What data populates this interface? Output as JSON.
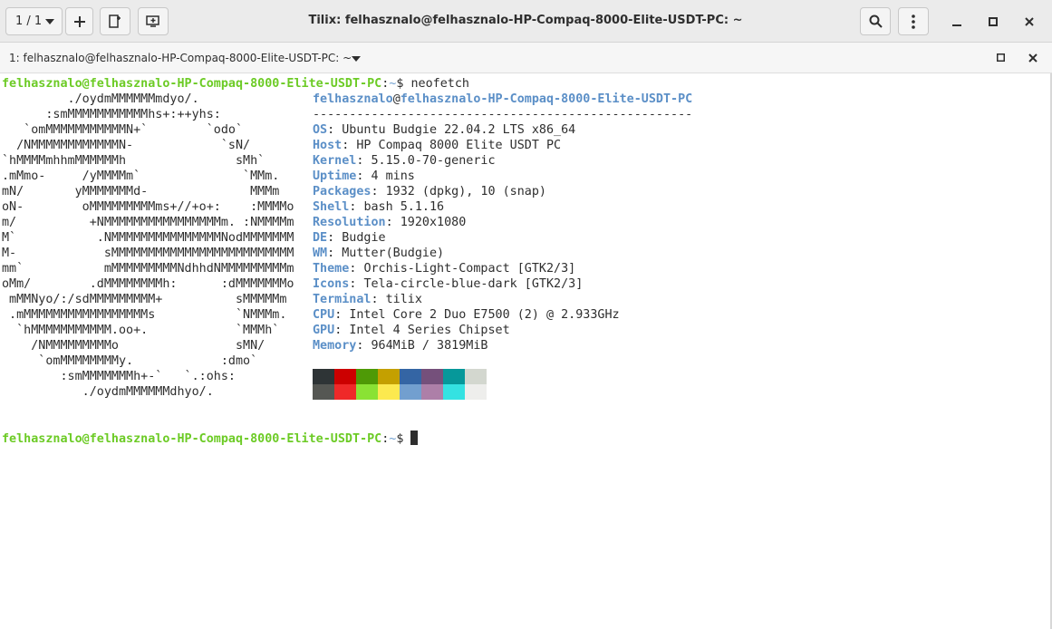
{
  "window": {
    "title": "Tilix: felhasznalo@felhasznalo-HP-Compaq-8000-Elite-USDT-PC: ~"
  },
  "headerbar": {
    "session_indicator": "1 / 1",
    "icons": [
      "chevron-down-icon",
      "plus-icon",
      "add-terminal-icon",
      "add-session-icon",
      "search-icon",
      "kebab-menu-icon",
      "minimize-icon",
      "maximize-icon",
      "close-icon"
    ]
  },
  "terminal_tab": {
    "title": "1: felhasznalo@felhasznalo-HP-Compaq-8000-Elite-USDT-PC: ~"
  },
  "prompt": {
    "user_host": "felhasznalo@felhasznalo-HP-Compaq-8000-Elite-USDT-PC",
    "sep": ":",
    "path": "~",
    "symbol": "$",
    "command": " neofetch"
  },
  "neofetch": {
    "logo_lines": [
      "         ./oydmMMMMMMmdyo/.",
      "      :smMMMMMMMMMMMhs+:++yhs:",
      "   `omMMMMMMMMMMMN+`        `odo`",
      "  /NMMMMMMMMMMMMN-            `sN/",
      "`hMMMMmhhmMMMMMMh               sMh`",
      ".mMmo-     /yMMMMm`              `MMm.",
      "mN/       yMMMMMMMd-              MMMm",
      "oN-        oMMMMMMMMMms+//+o+:    :MMMMo",
      "m/          +NMMMMMMMMMMMMMMMMm. :NMMMMm",
      "M`           .NMMMMMMMMMMMMMMMNodMMMMMMM",
      "M-            sMMMMMMMMMMMMMMMMMMMMMMMMM",
      "mm`           mMMMMMMMMMNdhhdNMMMMMMMMMm",
      "oMm/        .dMMMMMMMMh:      :dMMMMMMMo",
      " mMMNyo/:/sdMMMMMMMMM+          sMMMMMm",
      " .mMMMMMMMMMMMMMMMMMs           `NMMMm.",
      "  `hMMMMMMMMMMM.oo+.            `MMMh`",
      "    /NMMMMMMMMMo                sMN/",
      "     `omMMMMMMMMy.            :dmo`",
      "        :smMMMMMMMh+-`   `.:ohs:",
      "           ./oydmMMMMMMdhyo/."
    ],
    "header_user": "felhasznalo",
    "header_at": "@",
    "header_host": "felhasznalo-HP-Compaq-8000-Elite-USDT-PC",
    "separator": "----------------------------------------------------",
    "info": [
      {
        "key": "OS",
        "value": "Ubuntu Budgie 22.04.2 LTS x86_64"
      },
      {
        "key": "Host",
        "value": "HP Compaq 8000 Elite USDT PC"
      },
      {
        "key": "Kernel",
        "value": "5.15.0-70-generic"
      },
      {
        "key": "Uptime",
        "value": "4 mins"
      },
      {
        "key": "Packages",
        "value": "1932 (dpkg), 10 (snap)"
      },
      {
        "key": "Shell",
        "value": "bash 5.1.16"
      },
      {
        "key": "Resolution",
        "value": "1920x1080"
      },
      {
        "key": "DE",
        "value": "Budgie"
      },
      {
        "key": "WM",
        "value": "Mutter(Budgie)"
      },
      {
        "key": "Theme",
        "value": "Orchis-Light-Compact [GTK2/3]"
      },
      {
        "key": "Icons",
        "value": "Tela-circle-blue-dark [GTK2/3]"
      },
      {
        "key": "Terminal",
        "value": "tilix"
      },
      {
        "key": "CPU",
        "value": "Intel Core 2 Duo E7500 (2) @ 2.933GHz"
      },
      {
        "key": "GPU",
        "value": "Intel 4 Series Chipset"
      },
      {
        "key": "Memory",
        "value": "964MiB / 3819MiB"
      }
    ],
    "palette_dark": [
      "#2e3436",
      "#cc0000",
      "#4e9a06",
      "#c4a000",
      "#3465a4",
      "#75507b",
      "#06989a",
      "#d3d7cf"
    ],
    "palette_bright": [
      "#555753",
      "#ef2929",
      "#8ae234",
      "#fce94f",
      "#729fcf",
      "#ad7fa8",
      "#34e2e2",
      "#eeeeec"
    ]
  },
  "colors": {
    "prompt_green": "#6ccb25",
    "key_blue": "#5b8fc7",
    "text": "#2e2e2e"
  }
}
